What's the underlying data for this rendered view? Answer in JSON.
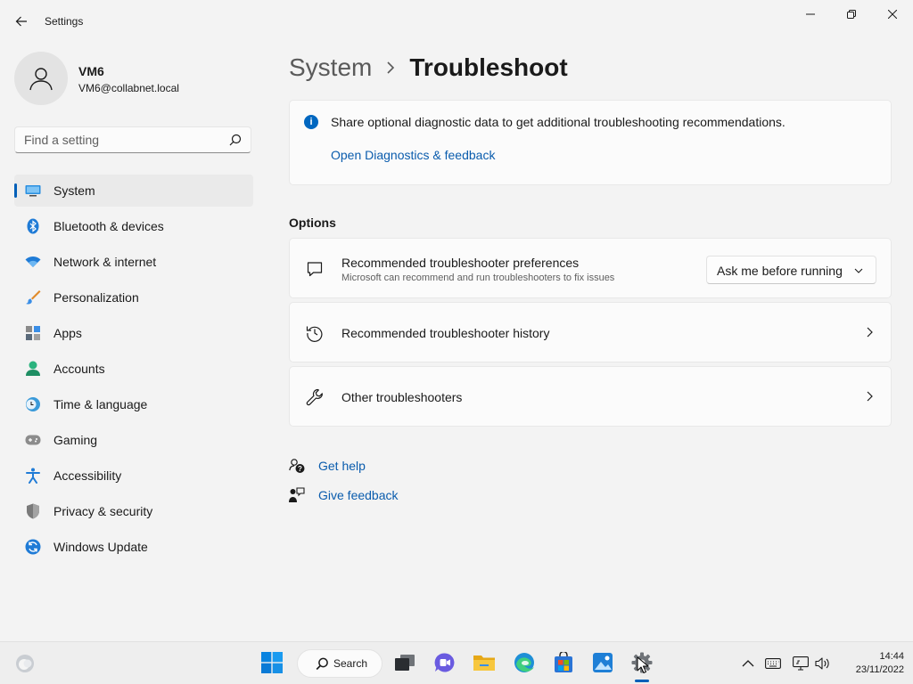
{
  "window": {
    "title": "Settings"
  },
  "user": {
    "name": "VM6",
    "email": "VM6@collabnet.local"
  },
  "search": {
    "placeholder": "Find a setting"
  },
  "sidebar": {
    "items": [
      {
        "label": "System",
        "icon": "system-icon",
        "active": true
      },
      {
        "label": "Bluetooth & devices",
        "icon": "bluetooth-icon"
      },
      {
        "label": "Network & internet",
        "icon": "wifi-icon"
      },
      {
        "label": "Personalization",
        "icon": "brush-icon"
      },
      {
        "label": "Apps",
        "icon": "apps-icon"
      },
      {
        "label": "Accounts",
        "icon": "accounts-icon"
      },
      {
        "label": "Time & language",
        "icon": "time-language-icon"
      },
      {
        "label": "Gaming",
        "icon": "gamepad-icon"
      },
      {
        "label": "Accessibility",
        "icon": "accessibility-icon"
      },
      {
        "label": "Privacy & security",
        "icon": "shield-icon"
      },
      {
        "label": "Windows Update",
        "icon": "update-icon"
      }
    ]
  },
  "breadcrumb": {
    "parent": "System",
    "current": "Troubleshoot"
  },
  "info": {
    "text": "Share optional diagnostic data to get additional troubleshooting recommendations.",
    "link": "Open Diagnostics & feedback"
  },
  "options": {
    "heading": "Options",
    "preferences": {
      "title": "Recommended troubleshooter preferences",
      "subtitle": "Microsoft can recommend and run troubleshooters to fix issues",
      "dropdown_value": "Ask me before running"
    },
    "history": {
      "title": "Recommended troubleshooter history"
    },
    "other": {
      "title": "Other troubleshooters"
    }
  },
  "help": {
    "get_help": "Get help",
    "give_feedback": "Give feedback"
  },
  "taskbar": {
    "search_label": "Search",
    "time": "14:44",
    "date": "23/11/2022"
  },
  "colors": {
    "accent": "#005fb8",
    "link": "#0a5cad",
    "background": "#f3f3f3"
  }
}
